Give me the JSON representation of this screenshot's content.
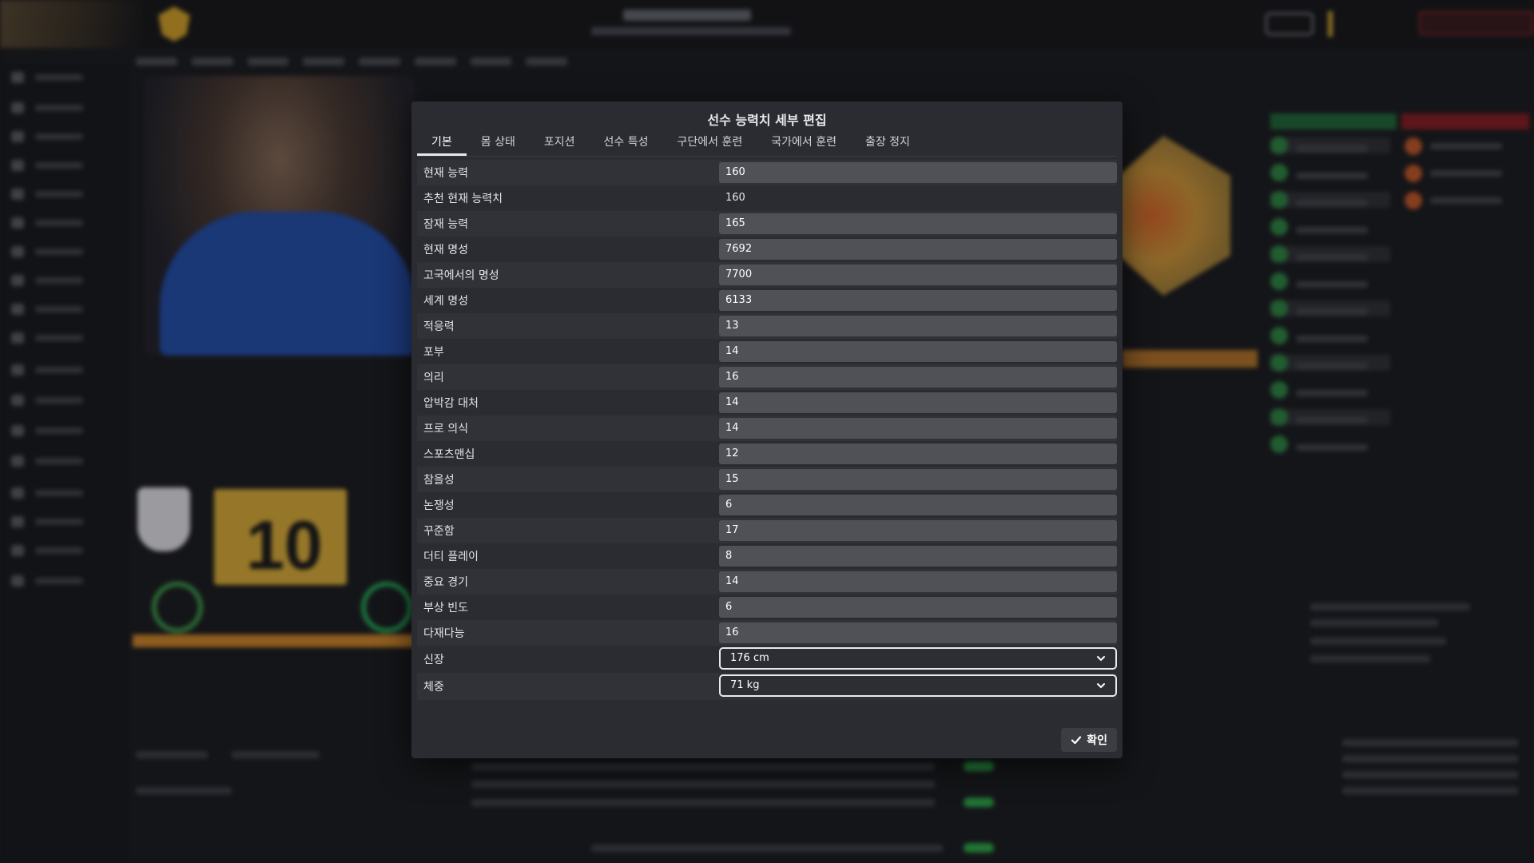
{
  "modal": {
    "title": "선수 능력치 세부 편집",
    "tabs": [
      {
        "label": "기본",
        "active": true
      },
      {
        "label": "몸 상태",
        "active": false
      },
      {
        "label": "포지션",
        "active": false
      },
      {
        "label": "선수 특성",
        "active": false
      },
      {
        "label": "구단에서 훈련",
        "active": false
      },
      {
        "label": "국가에서 훈련",
        "active": false
      },
      {
        "label": "출장 정지",
        "active": false
      }
    ],
    "fields": [
      {
        "label": "현재 능력",
        "value": "160",
        "kind": "input"
      },
      {
        "label": "추천 현재 능력치",
        "value": "160",
        "kind": "plain"
      },
      {
        "label": "잠재 능력",
        "value": "165",
        "kind": "input"
      },
      {
        "label": "현재 명성",
        "value": "7692",
        "kind": "input"
      },
      {
        "label": "고국에서의 명성",
        "value": "7700",
        "kind": "input"
      },
      {
        "label": "세계 명성",
        "value": "6133",
        "kind": "input"
      },
      {
        "label": "적응력",
        "value": "13",
        "kind": "input"
      },
      {
        "label": "포부",
        "value": "14",
        "kind": "input"
      },
      {
        "label": "의리",
        "value": "16",
        "kind": "input"
      },
      {
        "label": "압박감 대처",
        "value": "14",
        "kind": "input"
      },
      {
        "label": "프로 의식",
        "value": "14",
        "kind": "input"
      },
      {
        "label": "스포츠맨십",
        "value": "12",
        "kind": "input"
      },
      {
        "label": "참을성",
        "value": "15",
        "kind": "input"
      },
      {
        "label": "논쟁성",
        "value": "6",
        "kind": "input"
      },
      {
        "label": "꾸준함",
        "value": "17",
        "kind": "input"
      },
      {
        "label": "더티 플레이",
        "value": "8",
        "kind": "input"
      },
      {
        "label": "중요 경기",
        "value": "14",
        "kind": "input"
      },
      {
        "label": "부상 빈도",
        "value": "6",
        "kind": "input"
      },
      {
        "label": "다재다능",
        "value": "16",
        "kind": "input"
      },
      {
        "label": "신장",
        "value": "176 cm",
        "kind": "select"
      },
      {
        "label": "체중",
        "value": "71 kg",
        "kind": "select"
      }
    ],
    "confirm_label": "확인"
  },
  "background": {
    "shirt_number": "10"
  },
  "icons": {
    "confirm": "check-icon",
    "select": "chevron-down-icon"
  },
  "colors": {
    "modal_bg": "#2b2c31",
    "input_bg": "#4f5157",
    "accent_gold": "#d9a62a"
  }
}
